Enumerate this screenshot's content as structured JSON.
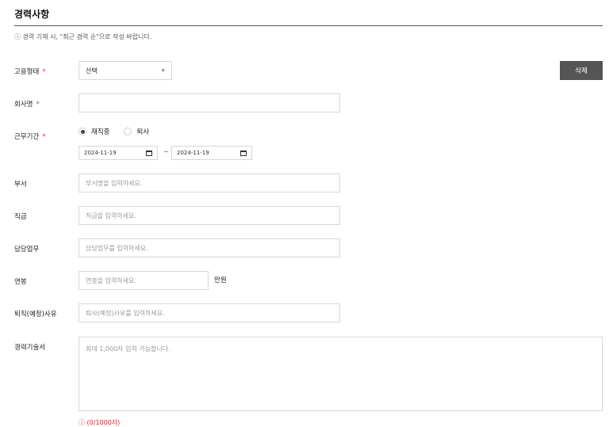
{
  "section": {
    "title": "경력사항",
    "notice": "ⓘ 경력 기재 시, \"최근 경력 순\"으로 작성 바랍니다."
  },
  "employment_type": {
    "label": "고용형태",
    "required_mark": "*",
    "selected": "선택",
    "delete_label": "삭제"
  },
  "company": {
    "label": "회사명",
    "required_mark": "*",
    "value": ""
  },
  "period": {
    "label": "근무기간",
    "required_mark": "*",
    "options": [
      {
        "label": "재직중",
        "checked": true
      },
      {
        "label": "퇴사",
        "checked": false
      }
    ],
    "start_date": "2024-11-19",
    "separator": "~",
    "end_date": "2024-11-19"
  },
  "department": {
    "label": "부서",
    "placeholder": "부서명을 입력하세요."
  },
  "position": {
    "label": "직급",
    "placeholder": "직급을 입력하세요."
  },
  "duty": {
    "label": "담당업무",
    "placeholder": "담당업무를 입력하세요."
  },
  "salary": {
    "label": "연봉",
    "placeholder": "연봉을 입력하세요.",
    "unit": "만원"
  },
  "resign_reason": {
    "label": "퇴직(예정)사유",
    "placeholder": "퇴사(예정)사유를 입력하세요."
  },
  "career_desc": {
    "label": "경력기술서",
    "placeholder": "최대 1,000자 입력 가능합니다.",
    "counter": "ⓘ (0/1000자)"
  }
}
